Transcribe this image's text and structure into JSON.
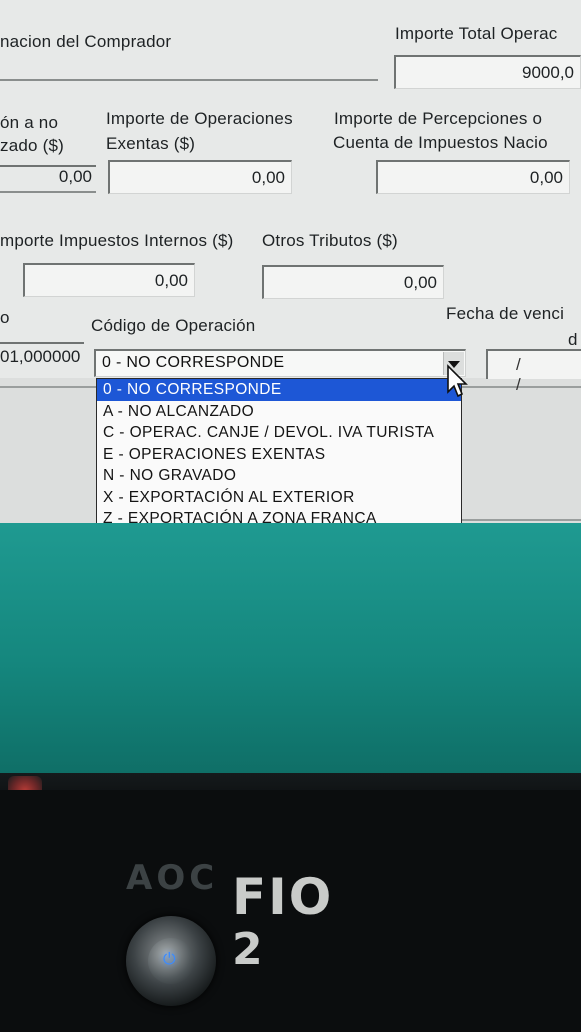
{
  "form": {
    "labels": {
      "comprador": "nacion del Comprador",
      "importe_total": "Importe Total Operac",
      "no_gravado_line1": "ón a no",
      "no_gravado_line2": "zado ($)",
      "exentas_line1": "Importe de Operaciones",
      "exentas_line2": "Exentas ($)",
      "percepciones_line1": "Importe de Percepciones o",
      "percepciones_line2": "Cuenta de Impuestos Nacio",
      "impuestos_internos": "mporte Impuestos Internos ($)",
      "otros_tributos": "Otros Tributos ($)",
      "tipo_cambio": "o",
      "codigo_operacion": "Código de Operación",
      "fecha_venc_line1": "Fecha de venci",
      "fecha_venc_line2": "d"
    },
    "values": {
      "importe_total": "9000,0",
      "no_gravado": "0,00",
      "exentas": "0,00",
      "percepciones": "0,00",
      "impuestos_internos": "0,00",
      "otros_tributos": "0,00",
      "tipo_cambio": "01,000000",
      "fecha_venc": "/ /"
    }
  },
  "codigo_operacion": {
    "selected": "0 - NO CORRESPONDE",
    "options": [
      "0 - NO CORRESPONDE",
      "A - NO ALCANZADO",
      "C - OPERAC. CANJE / DEVOL. IVA TURISTA",
      "E - OPERACIONES EXENTAS",
      "N - NO GRAVADO",
      "X - EXPORTACIÓN AL EXTERIOR",
      "Z - EXPORTACIÓN A ZONA FRANCA"
    ],
    "highlighted_index": 0,
    "selection_color": "#1d57d6"
  },
  "desktop": {
    "background_color": "#1a9088"
  },
  "monitor": {
    "brand_text": "AOC",
    "sticker_line1": "FIO",
    "sticker_line2": "2",
    "power_icon": "power-icon"
  }
}
